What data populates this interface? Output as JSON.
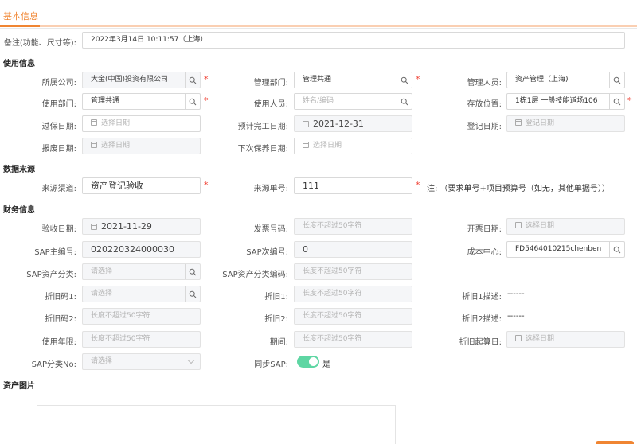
{
  "tab": {
    "label": "基本信息"
  },
  "remark": {
    "label": "备注(功能、尺寸等):",
    "value": "2022年3月14日 10:11:57（上海）"
  },
  "sections": {
    "usage": "使用信息",
    "source": "数据来源",
    "finance": "财务信息",
    "images": "资产图片"
  },
  "usage": {
    "company": {
      "label": "所属公司:",
      "value": "大金(中国)投资有限公司"
    },
    "manage_dept": {
      "label": "管理部门:",
      "value": "管理共通"
    },
    "manager": {
      "label": "管理人员:",
      "value": "资产管理（上海)"
    },
    "use_dept": {
      "label": "使用部门:",
      "value": "管理共通"
    },
    "user": {
      "label": "使用人员:",
      "placeholder": "姓名/编码"
    },
    "location": {
      "label": "存放位置:",
      "value": "1栋1层 一般技能道场106"
    },
    "warranty_date": {
      "label": "过保日期:",
      "placeholder": "选择日期"
    },
    "expected_finish": {
      "label": "预计完工日期:",
      "value": "2021-12-31"
    },
    "register_date": {
      "label": "登记日期:",
      "placeholder": "登记日期"
    },
    "scrap_date": {
      "label": "报废日期:",
      "placeholder": "选择日期"
    },
    "next_maint": {
      "label": "下次保养日期:",
      "placeholder": "选择日期"
    }
  },
  "source": {
    "channel": {
      "label": "来源渠道:",
      "value": "资产登记验收"
    },
    "doc_no": {
      "label": "来源单号:",
      "value": "111"
    },
    "note": "注: （要求单号+项目预算号（如无，其他单据号））"
  },
  "finance": {
    "accept_date": {
      "label": "验收日期:",
      "value": "2021-11-29"
    },
    "invoice_no": {
      "label": "发票号码:",
      "placeholder": "长度不超过50字符"
    },
    "invoice_date": {
      "label": "开票日期:",
      "placeholder": "选择日期"
    },
    "sap_main": {
      "label": "SAP主编号:",
      "value": "020220324000030"
    },
    "sap_sub": {
      "label": "SAP次编号:",
      "value": "0"
    },
    "cost_center": {
      "label": "成本中心:",
      "value": "FD5464010215chenben"
    },
    "sap_class": {
      "label": "SAP资产分类:",
      "placeholder": "请选择"
    },
    "sap_class_code": {
      "label": "SAP资产分类编码:",
      "placeholder": "长度不超过50字符"
    },
    "dep_code1": {
      "label": "折旧码1:",
      "placeholder": "请选择"
    },
    "dep1": {
      "label": "折旧1:",
      "placeholder": "长度不超过50字符"
    },
    "dep1_desc": {
      "label": "折旧1描述:",
      "value": "------"
    },
    "dep_code2": {
      "label": "折旧码2:",
      "placeholder": "长度不超过50字符"
    },
    "dep2": {
      "label": "折旧2:",
      "placeholder": "长度不超过50字符"
    },
    "dep2_desc": {
      "label": "折旧2描述:",
      "value": "------"
    },
    "life": {
      "label": "使用年限:",
      "placeholder": "长度不超过50字符"
    },
    "period": {
      "label": "期间:",
      "placeholder": "长度不超过50字符"
    },
    "dep_start": {
      "label": "折旧起算日:",
      "placeholder": "选择日期"
    },
    "sap_class_no": {
      "label": "SAP分类No:",
      "placeholder": "请选择"
    },
    "sync_sap": {
      "label": "同步SAP:",
      "value": "是"
    }
  },
  "colors": {
    "accent": "#f08532",
    "required": "#f04134",
    "switch_on": "#5ed6a3"
  },
  "icons": {
    "search": "search-icon",
    "calendar": "calendar-icon",
    "chevron": "chevron-down-icon"
  }
}
